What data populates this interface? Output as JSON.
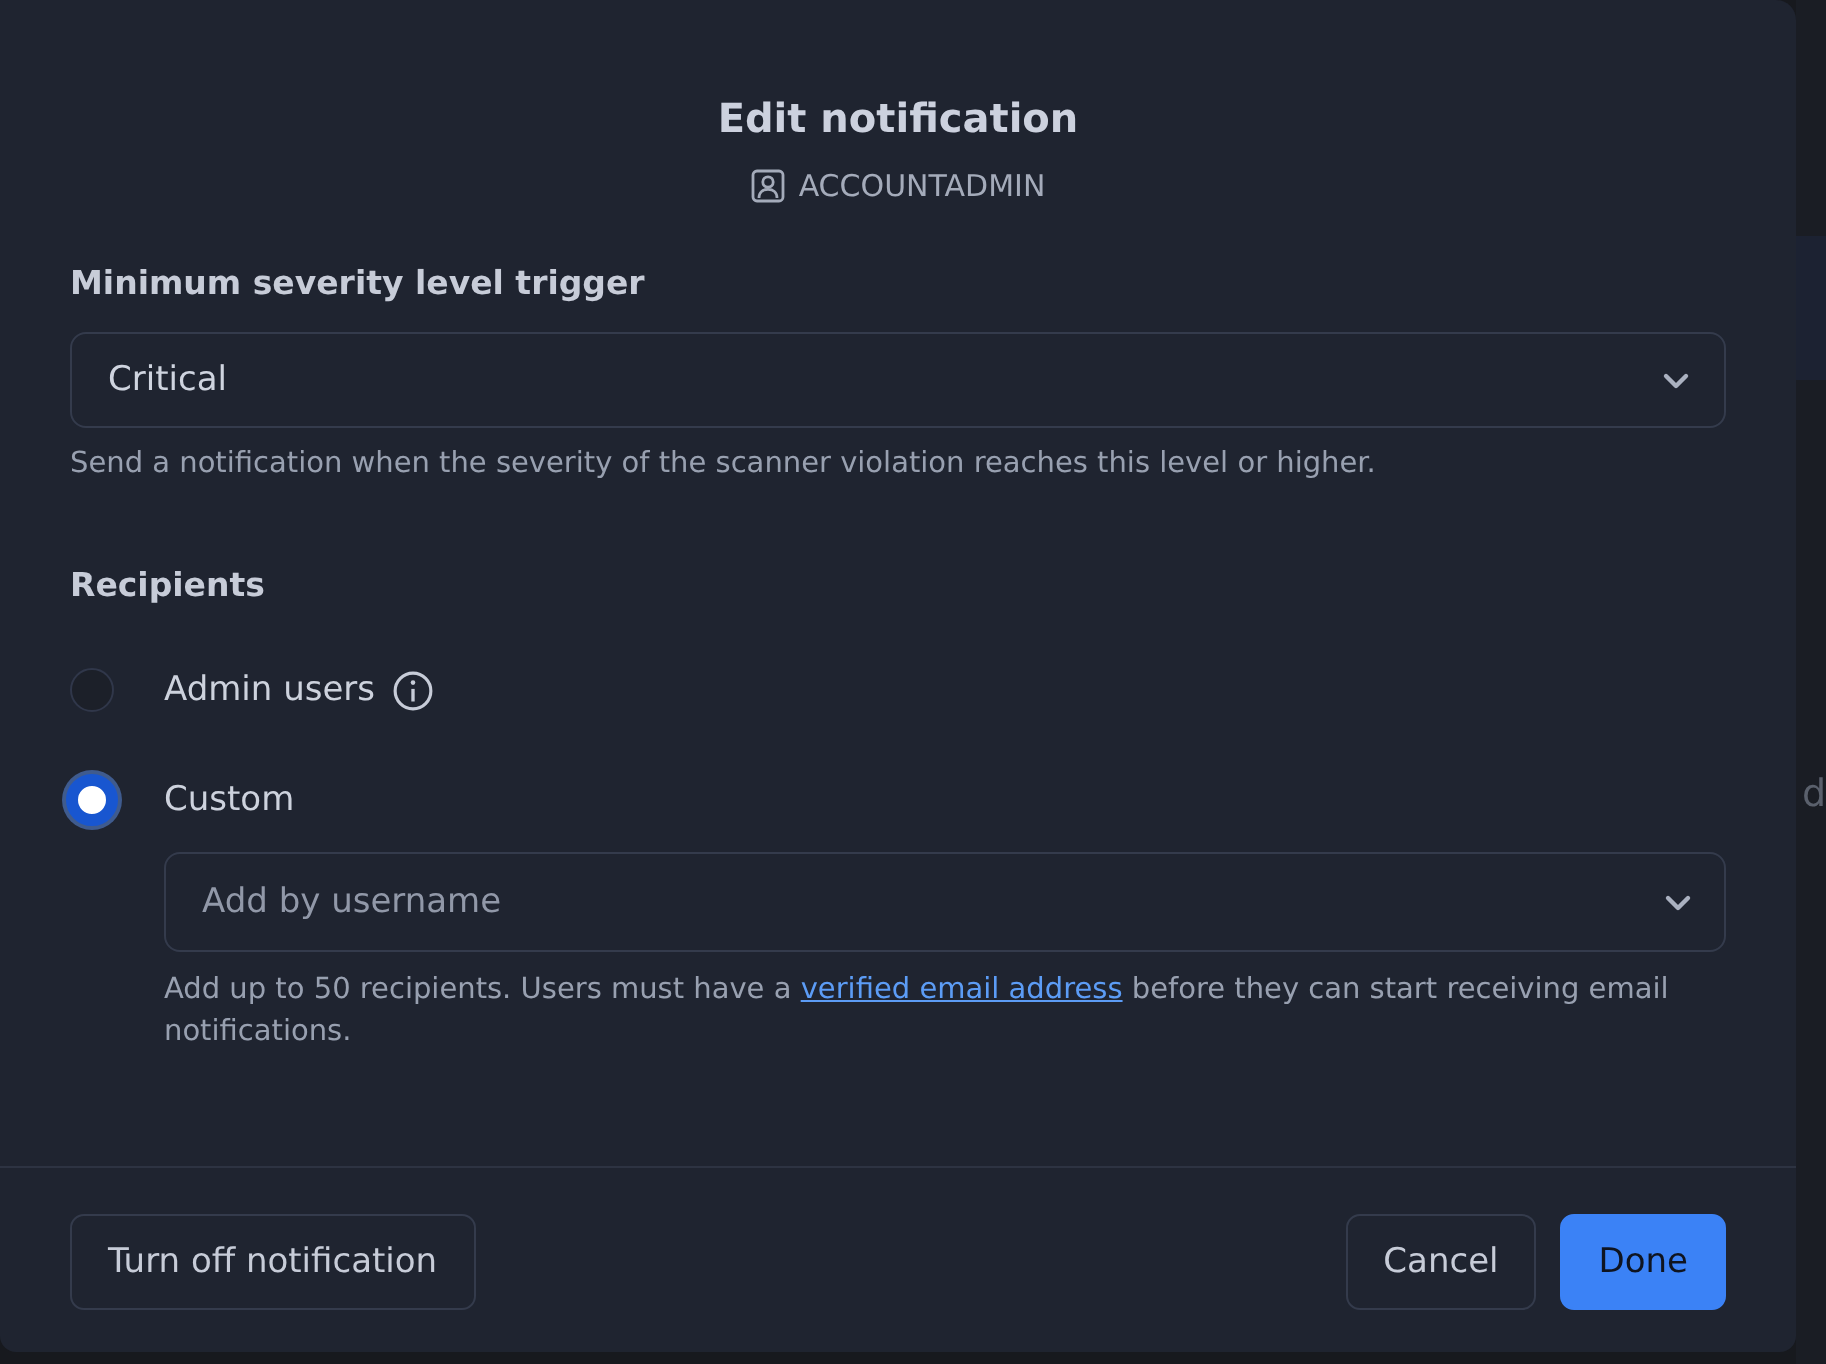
{
  "dialog": {
    "title": "Edit notification",
    "role": "ACCOUNTADMIN"
  },
  "severity": {
    "label": "Minimum severity level trigger",
    "value": "Critical",
    "help": "Send a notification when the severity of the scanner violation reaches this level or higher."
  },
  "recipients": {
    "label": "Recipients",
    "options": [
      {
        "label": "Admin users",
        "selected": false,
        "info": true
      },
      {
        "label": "Custom",
        "selected": true,
        "info": false
      }
    ],
    "field": {
      "placeholder": "Add by username"
    },
    "help": {
      "before": "Add up to 50 recipients. Users must have a ",
      "link": "verified email address",
      "after": " before they can start receiving email notifications."
    }
  },
  "footer": {
    "secondary": "Turn off notification",
    "cancel": "Cancel",
    "primary": "Done"
  },
  "background_text": "d"
}
